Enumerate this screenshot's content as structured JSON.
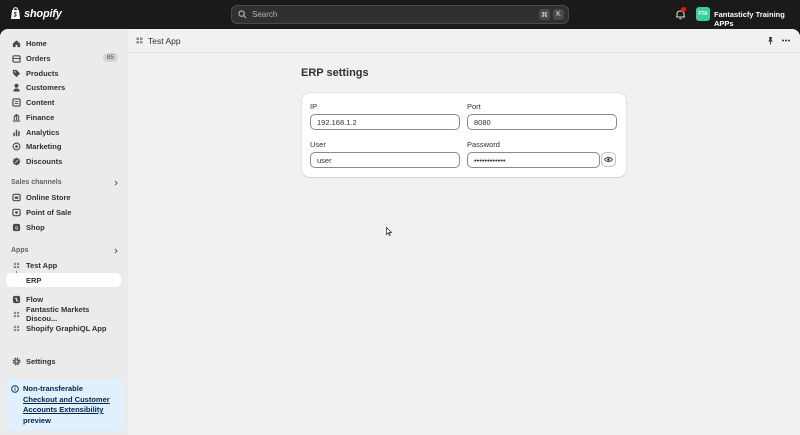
{
  "topbar": {
    "brand": "shopify",
    "search_placeholder": "Search",
    "shortcut_keys": [
      "⌘",
      "K"
    ],
    "store_initials": "FTA",
    "store_name": "Fantasticfy Training APPs"
  },
  "sidebar": {
    "items": [
      {
        "label": "Home",
        "icon": "home-icon"
      },
      {
        "label": "Orders",
        "icon": "orders-icon",
        "count": "85"
      },
      {
        "label": "Products",
        "icon": "tag-icon"
      },
      {
        "label": "Customers",
        "icon": "person-icon"
      },
      {
        "label": "Content",
        "icon": "content-icon"
      },
      {
        "label": "Finance",
        "icon": "bank-icon"
      },
      {
        "label": "Analytics",
        "icon": "chart-icon"
      },
      {
        "label": "Marketing",
        "icon": "target-icon"
      },
      {
        "label": "Discounts",
        "icon": "discount-icon"
      }
    ],
    "sales_channels_label": "Sales channels",
    "sales_channels": [
      {
        "label": "Online Store",
        "icon": "store-icon"
      },
      {
        "label": "Point of Sale",
        "icon": "pos-icon"
      },
      {
        "label": "Shop",
        "icon": "shop-icon"
      }
    ],
    "apps_label": "Apps",
    "apps": [
      {
        "label": "Test App",
        "icon": "app-grid-icon"
      },
      {
        "label": "ERP",
        "icon": "",
        "active": true
      },
      {
        "label": "Flow",
        "icon": "flow-icon"
      },
      {
        "label": "Fantastic Markets Discou...",
        "icon": "app-grid-icon"
      },
      {
        "label": "Shopify GraphiQL App",
        "icon": "app-grid-icon"
      }
    ],
    "settings_label": "Settings",
    "banner": {
      "title": "Non-transferable",
      "link": "Checkout and Customer Accounts Extensibility",
      "suffix": "preview"
    }
  },
  "main": {
    "app_title": "Test App",
    "page_title": "ERP settings",
    "form": {
      "ip_label": "IP",
      "ip_value": "192.168.1.2",
      "port_label": "Port",
      "port_value": "8080",
      "user_label": "User",
      "user_value": "user",
      "password_label": "Password",
      "password_value": "••••••••••••"
    }
  },
  "colors": {
    "topbar_bg": "#1a1a1a",
    "sidebar_bg": "#ebebeb",
    "main_bg": "#f1f1f1",
    "store_badge": "#36d399",
    "notification_dot": "#e51c00",
    "banner_bg": "#e0f0ff"
  }
}
